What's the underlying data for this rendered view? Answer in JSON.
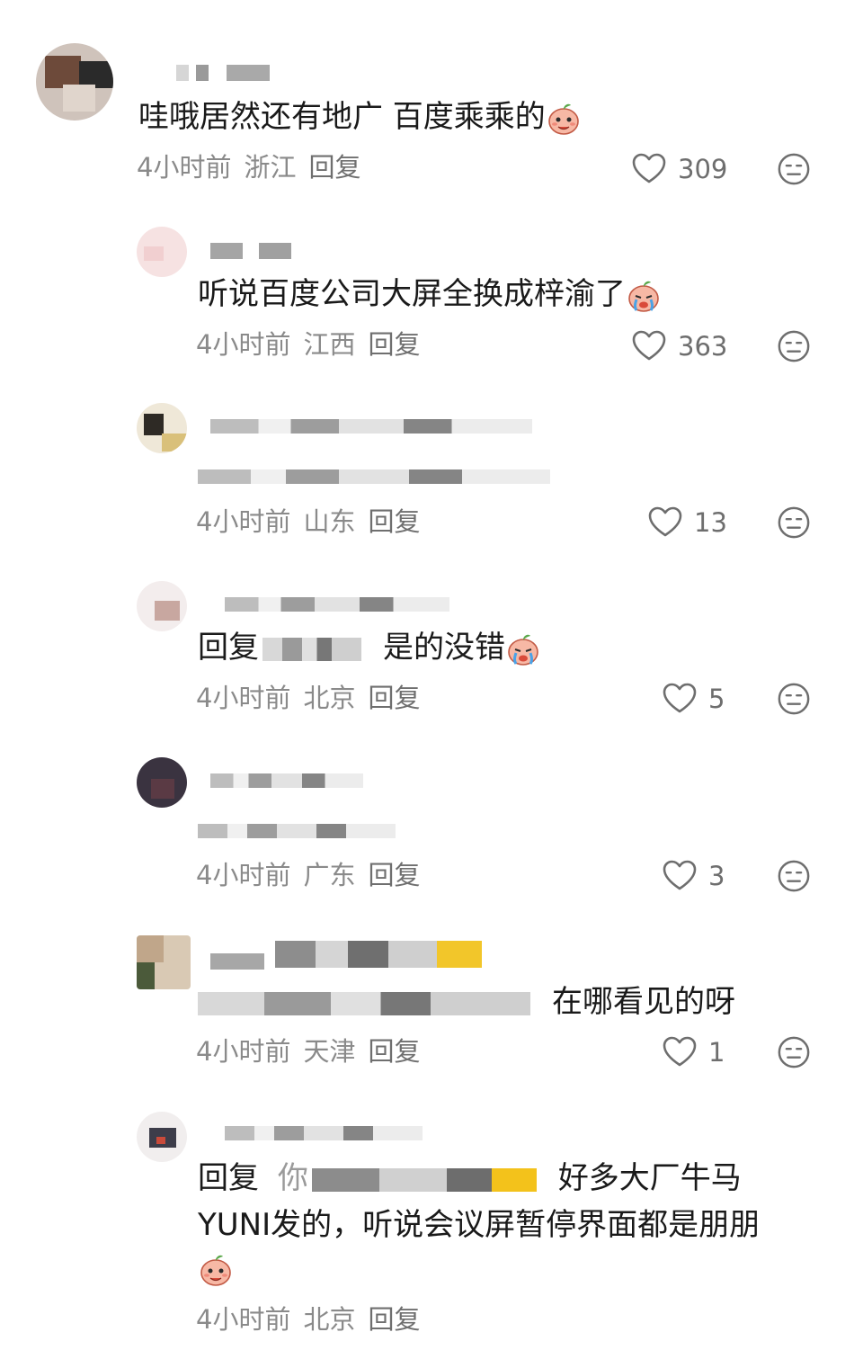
{
  "comments": [
    {
      "text": "哇哦居然还有地广 百度乘乘的",
      "time": "4小时前",
      "location": "浙江",
      "reply": "回复",
      "likes": "309"
    },
    {
      "text": "听说百度公司大屏全换成梓渝了",
      "time": "4小时前",
      "location": "江西",
      "reply": "回复",
      "likes": "363"
    },
    {
      "time": "4小时前",
      "location": "山东",
      "reply": "回复",
      "likes": "13"
    },
    {
      "prefix": "回复",
      "text": "是的没错",
      "time": "4小时前",
      "location": "北京",
      "reply": "回复",
      "likes": "5"
    },
    {
      "time": "4小时前",
      "location": "广东",
      "reply": "回复",
      "likes": "3"
    },
    {
      "text": "在哪看见的呀",
      "time": "4小时前",
      "location": "天津",
      "reply": "回复",
      "likes": "1"
    },
    {
      "prefix": "回复",
      "prefix2": "你",
      "text_line1": "好多大厂牛马",
      "text_line2": "YUNI发的，听说会议屏暂停界面都是朋朋",
      "time": "4小时前",
      "location": "北京",
      "reply": "回复"
    }
  ],
  "icons": {
    "like": "heart-outline-icon",
    "dislike": "neutral-face-icon",
    "emoji": "peach-face-emoji"
  },
  "colors": {
    "text": "#1a1a1a",
    "meta": "#8a8a8a",
    "icon": "#6e6e6e"
  }
}
